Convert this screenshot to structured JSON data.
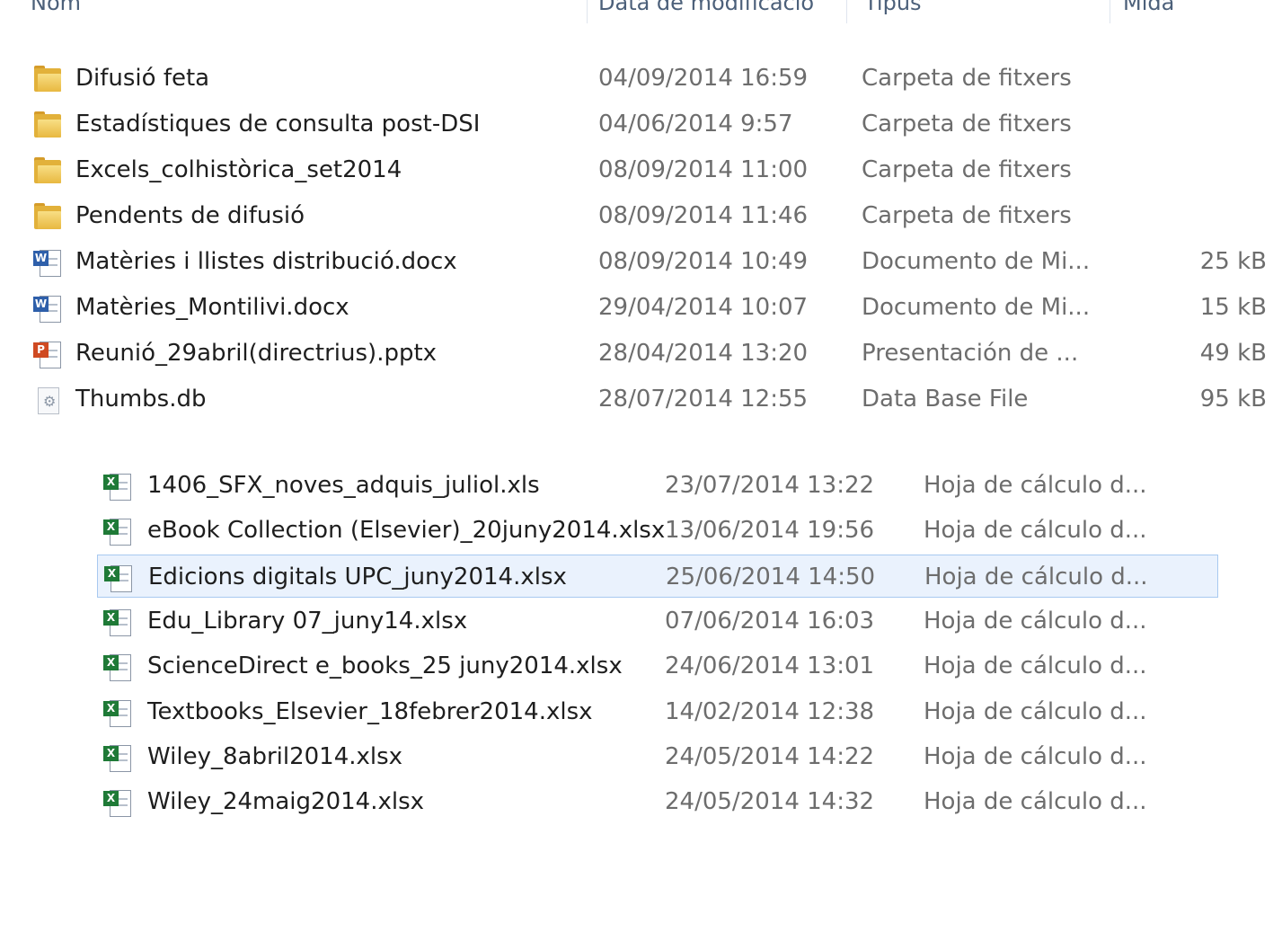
{
  "header": {
    "name": "Nom",
    "date": "Data de modificació",
    "type": "Tipus",
    "size": "Mida"
  },
  "top_files": [
    {
      "icon": "folder-icon",
      "name": "Difusió feta",
      "date": "04/09/2014 16:59",
      "type": "Carpeta de fitxers",
      "size": ""
    },
    {
      "icon": "folder-icon",
      "name": "Estadístiques de consulta post-DSI",
      "date": "04/06/2014 9:57",
      "type": "Carpeta de fitxers",
      "size": ""
    },
    {
      "icon": "folder-icon",
      "name": "Excels_colhistòrica_set2014",
      "date": "08/09/2014 11:00",
      "type": "Carpeta de fitxers",
      "size": ""
    },
    {
      "icon": "folder-icon",
      "name": "Pendents de difusió",
      "date": "08/09/2014 11:46",
      "type": "Carpeta de fitxers",
      "size": ""
    },
    {
      "icon": "word-doc-icon",
      "name": "Matèries i llistes distribució.docx",
      "date": "08/09/2014 10:49",
      "type": "Documento de Mi...",
      "size": "25 kB"
    },
    {
      "icon": "word-doc-icon",
      "name": "Matèries_Montilivi.docx",
      "date": "29/04/2014 10:07",
      "type": "Documento de Mi...",
      "size": "15 kB"
    },
    {
      "icon": "powerpoint-doc-icon",
      "name": "Reunió_29abril(directrius).pptx",
      "date": "28/04/2014 13:20",
      "type": "Presentación de ...",
      "size": "49 kB"
    },
    {
      "icon": "database-file-icon",
      "name": "Thumbs.db",
      "date": "28/07/2014 12:55",
      "type": "Data Base File",
      "size": "95 kB"
    }
  ],
  "bottom_files": [
    {
      "icon": "excel-doc-icon",
      "name": "1406_SFX_noves_adquis_juliol.xls",
      "date": "23/07/2014 13:22",
      "type": "Hoja de cálculo d..."
    },
    {
      "icon": "excel-doc-icon",
      "name": "eBook Collection (Elsevier)_20juny2014.xlsx",
      "date": "13/06/2014 19:56",
      "type": "Hoja de cálculo d..."
    },
    {
      "icon": "excel-doc-icon",
      "name": "Edicions digitals UPC_juny2014.xlsx",
      "date": "25/06/2014 14:50",
      "type": "Hoja de cálculo d...",
      "selected": true
    },
    {
      "icon": "excel-doc-icon",
      "name": "Edu_Library 07_juny14.xlsx",
      "date": "07/06/2014 16:03",
      "type": "Hoja de cálculo d..."
    },
    {
      "icon": "excel-doc-icon",
      "name": "ScienceDirect e_books_25 juny2014.xlsx",
      "date": "24/06/2014 13:01",
      "type": "Hoja de cálculo d..."
    },
    {
      "icon": "excel-doc-icon",
      "name": "Textbooks_Elsevier_18febrer2014.xlsx",
      "date": "14/02/2014 12:38",
      "type": "Hoja de cálculo d..."
    },
    {
      "icon": "excel-doc-icon",
      "name": "Wiley_8abril2014.xlsx",
      "date": "24/05/2014 14:22",
      "type": "Hoja de cálculo d..."
    },
    {
      "icon": "excel-doc-icon",
      "name": "Wiley_24maig2014.xlsx",
      "date": "24/05/2014 14:32",
      "type": "Hoja de cálculo d..."
    }
  ]
}
